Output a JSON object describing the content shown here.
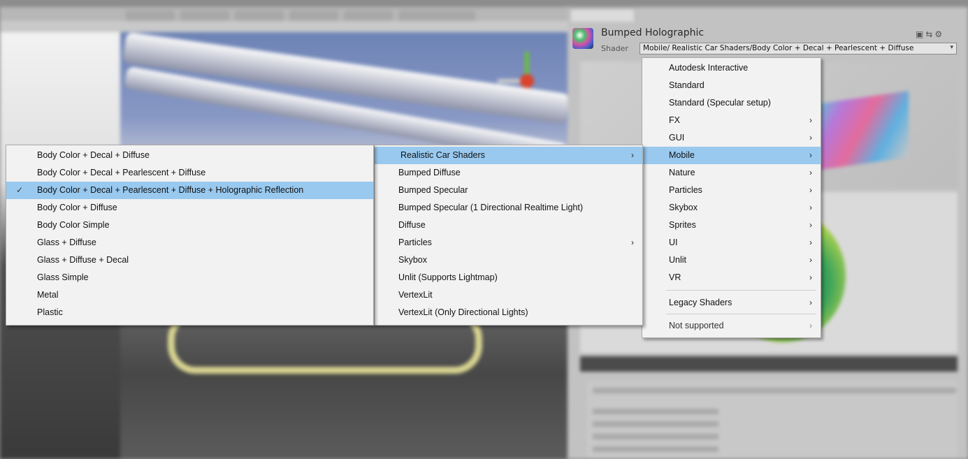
{
  "inspector": {
    "material_name": "Bumped Holographic",
    "shader_label": "Shader",
    "shader_value": "Mobile/ Realistic Car Shaders/Body Color + Decal + Pearlescent + Diffuse"
  },
  "menu_root": {
    "items": [
      {
        "label": "Autodesk Interactive",
        "submenu": false
      },
      {
        "label": "Standard",
        "submenu": false
      },
      {
        "label": "Standard (Specular setup)",
        "submenu": false
      },
      {
        "label": "FX",
        "submenu": true
      },
      {
        "label": "GUI",
        "submenu": true
      },
      {
        "label": "Mobile",
        "submenu": true,
        "highlighted": true
      },
      {
        "label": "Nature",
        "submenu": true
      },
      {
        "label": "Particles",
        "submenu": true
      },
      {
        "label": "Skybox",
        "submenu": true
      },
      {
        "label": "Sprites",
        "submenu": true
      },
      {
        "label": "UI",
        "submenu": true
      },
      {
        "label": "Unlit",
        "submenu": true
      },
      {
        "label": "VR",
        "submenu": true
      },
      {
        "label": "Legacy Shaders",
        "submenu": true
      },
      {
        "label": "Not supported",
        "submenu": true
      }
    ]
  },
  "menu_mobile": {
    "items": [
      {
        "label": "Realistic Car Shaders",
        "submenu": true,
        "highlighted": true
      },
      {
        "label": "Bumped Diffuse",
        "submenu": false
      },
      {
        "label": "Bumped Specular",
        "submenu": false
      },
      {
        "label": "Bumped Specular (1 Directional Realtime Light)",
        "submenu": false
      },
      {
        "label": "Diffuse",
        "submenu": false
      },
      {
        "label": "Particles",
        "submenu": true
      },
      {
        "label": "Skybox",
        "submenu": false
      },
      {
        "label": "Unlit (Supports Lightmap)",
        "submenu": false
      },
      {
        "label": "VertexLit",
        "submenu": false
      },
      {
        "label": "VertexLit (Only Directional Lights)",
        "submenu": false
      }
    ]
  },
  "menu_car": {
    "items": [
      {
        "label": "Body Color + Decal + Diffuse"
      },
      {
        "label": "Body Color + Decal + Pearlescent + Diffuse"
      },
      {
        "label": "Body Color + Decal + Pearlescent + Diffuse + Holographic Reflection",
        "checked": true,
        "highlighted": true
      },
      {
        "label": "Body Color + Diffuse"
      },
      {
        "label": "Body Color Simple"
      },
      {
        "label": "Glass + Diffuse"
      },
      {
        "label": "Glass + Diffuse + Decal"
      },
      {
        "label": "Glass Simple"
      },
      {
        "label": "Metal"
      },
      {
        "label": "Plastic"
      }
    ]
  },
  "icons": {
    "submenu_arrow": "›",
    "check": "✓",
    "dropdown_arrow": "▾"
  },
  "colors": {
    "highlight": "#99c9ef",
    "menu_bg": "#f2f2f2"
  }
}
